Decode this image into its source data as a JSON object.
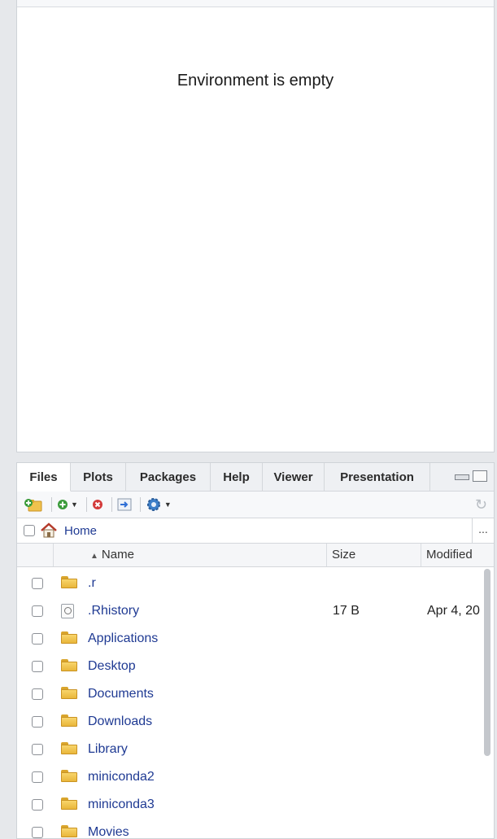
{
  "environment": {
    "empty_message": "Environment is empty"
  },
  "files_pane": {
    "tabs": [
      {
        "label": "Files",
        "active": true
      },
      {
        "label": "Plots",
        "active": false
      },
      {
        "label": "Packages",
        "active": false
      },
      {
        "label": "Help",
        "active": false
      },
      {
        "label": "Viewer",
        "active": false
      },
      {
        "label": "Presentation",
        "active": false
      }
    ],
    "toolbar": {
      "icons": [
        "new-folder-icon",
        "add-file-icon",
        "delete-icon",
        "rename-icon",
        "gear-icon",
        "refresh-icon"
      ]
    },
    "path": {
      "home_label": "Home",
      "more_label": "..."
    },
    "columns": {
      "name": "Name",
      "size": "Size",
      "modified": "Modified"
    },
    "rows": [
      {
        "name": ".r",
        "type": "folder",
        "size": "",
        "modified": ""
      },
      {
        "name": ".Rhistory",
        "type": "file",
        "size": "17 B",
        "modified": "Apr 4, 20"
      },
      {
        "name": "Applications",
        "type": "folder",
        "size": "",
        "modified": ""
      },
      {
        "name": "Desktop",
        "type": "folder",
        "size": "",
        "modified": ""
      },
      {
        "name": "Documents",
        "type": "folder",
        "size": "",
        "modified": ""
      },
      {
        "name": "Downloads",
        "type": "folder",
        "size": "",
        "modified": ""
      },
      {
        "name": "Library",
        "type": "folder",
        "size": "",
        "modified": ""
      },
      {
        "name": "miniconda2",
        "type": "folder",
        "size": "",
        "modified": ""
      },
      {
        "name": "miniconda3",
        "type": "folder",
        "size": "",
        "modified": ""
      },
      {
        "name": "Movies",
        "type": "folder",
        "size": "",
        "modified": ""
      }
    ]
  },
  "colors": {
    "link": "#1f3a93",
    "folder": "#f0c24d",
    "chrome": "#eef0f3"
  }
}
